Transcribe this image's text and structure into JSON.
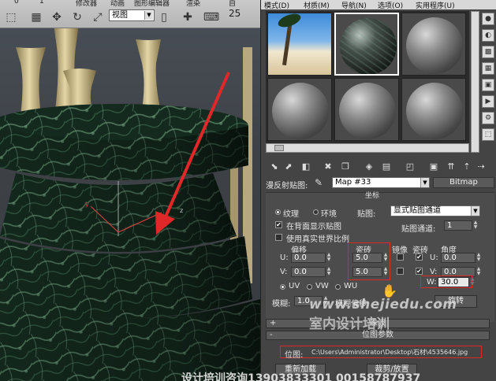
{
  "viewport": {
    "menu": [
      "0",
      "1",
      "修改器",
      "动画",
      "图形编辑器",
      "渲染",
      "自"
    ],
    "view_dropdown": "视图",
    "snap_value": "25"
  },
  "material_editor": {
    "menu": [
      "模式(D)",
      "材质(M)",
      "导航(N)",
      "选项(O)",
      "实用程序(U)"
    ],
    "map_label": "漫反射贴图:",
    "map_name": "Map #33",
    "map_type_button": "Bitmap",
    "coords": {
      "title": "坐标",
      "texture_label": "纹理",
      "environ_label": "环境",
      "mapping_label": "贴图:",
      "mapping_value": "显式贴图通道",
      "show_map_back": "在背面显示贴图",
      "map_channel_label": "贴图通道:",
      "map_channel_value": "1",
      "use_real_world": "使用真实世界比例",
      "offset_header": "偏移",
      "tiling_header": "瓷砖",
      "mirror_header": "镜像",
      "tile_header": "瓷砖",
      "angle_header": "角度",
      "u_label": "U:",
      "v_label": "V:",
      "w_label": "W:",
      "u_offset": "0.0",
      "v_offset": "0.0",
      "u_tiling": "5.0",
      "v_tiling": "5.0",
      "u_angle": "0.0",
      "v_angle": "0.0",
      "w_angle": "30.0",
      "uv_label": "UV",
      "vw_label": "VW",
      "wu_label": "WU",
      "blur_label": "模糊:",
      "blur_value": "1.0",
      "blur_offset_label": "模糊偏移:",
      "rotate_button": "旋转"
    },
    "noise_rollout": "噪波",
    "bitmap_params_rollout": "位图参数",
    "bitmap_label": "位图:",
    "bitmap_path": "C:\\Users\\Administrator\\Desktop\\石材\\4535646.jpg",
    "reload_button": "重新加载",
    "crop_button": "裁剪/放置"
  },
  "watermark": {
    "url": "www.shejiedu.com",
    "brand": "室内设计培训",
    "phone": "设计培训咨询13903833301 00158787937"
  },
  "colors": {
    "highlight_red": "#e02828",
    "marble_green": "#1e3326",
    "panel_gray": "#4c4c4c"
  }
}
